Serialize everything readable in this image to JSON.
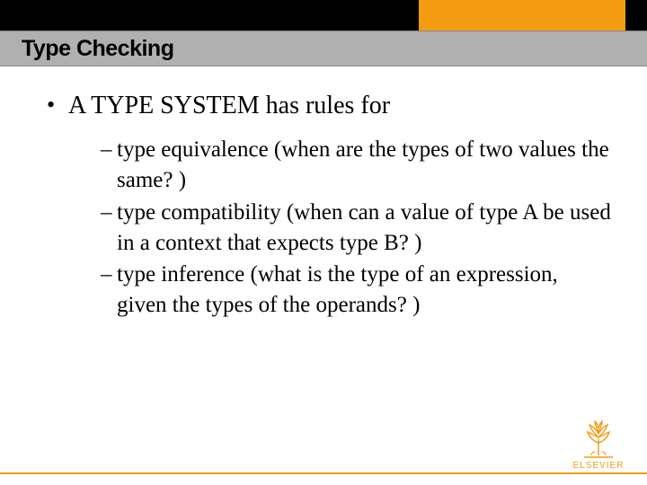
{
  "slide": {
    "title": "Type Checking",
    "main_bullet": "A TYPE SYSTEM has rules for",
    "sub_bullets": [
      "type equivalence (when are the types of two values the same? )",
      "type compatibility (when can a value of type A be used in a context that expects type B? )",
      "type inference (what is the type of an expression, given the types of the operands? )"
    ],
    "logo_text": "ELSEVIER"
  },
  "colors": {
    "accent_orange": "#f39c12",
    "title_bar": "#b0b0b0",
    "top_bar": "#000000"
  }
}
